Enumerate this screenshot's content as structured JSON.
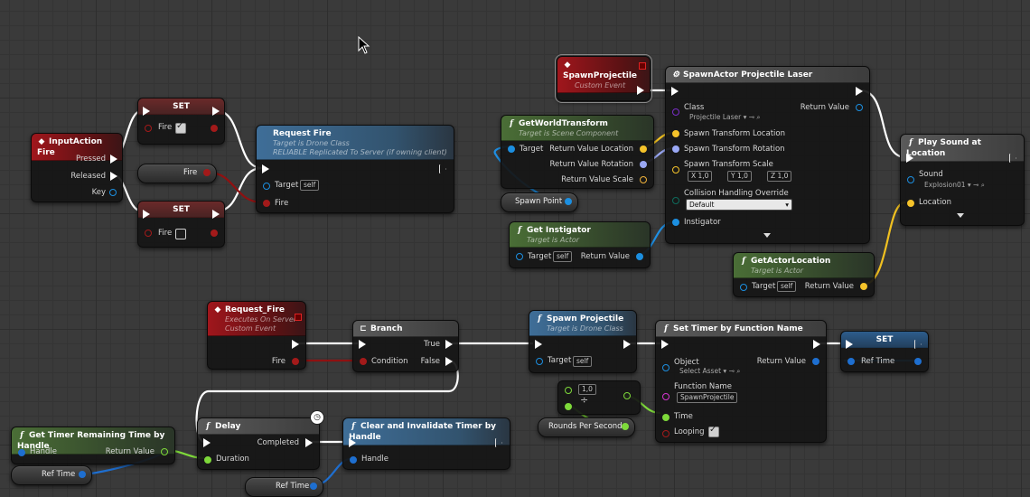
{
  "colors": {
    "exec": "#ffffff",
    "object": "#1c8fe0",
    "vector": "#f5c32a",
    "rotator": "#9aa8f5",
    "transform": "#f0b23a",
    "bool": "#a31a1a",
    "float": "#7ed93a",
    "struct": "#1e6fd0",
    "name": "#d535d0",
    "class": "#7a2dc7",
    "enum": "#0e6b5c"
  },
  "nodes": {
    "input_fire": {
      "title": "InputAction Fire",
      "pressed": "Pressed",
      "released": "Released",
      "key": "Key"
    },
    "set_true": {
      "title": "SET",
      "fire": "Fire"
    },
    "set_false": {
      "title": "SET",
      "fire": "Fire"
    },
    "fire_var": {
      "label": "Fire"
    },
    "request_fire": {
      "title": "Request Fire",
      "sub1": "Target is Drone Class",
      "sub2": "RELIABLE Replicated To Server (if owning client)",
      "target": "Target",
      "target_val": "self",
      "fire": "Fire"
    },
    "spawn_event": {
      "title": "SpawnProjectile",
      "sub": "Custom Event"
    },
    "get_world_transform": {
      "title": "GetWorldTransform",
      "sub": "Target is Scene Component",
      "target": "Target",
      "ret_loc": "Return Value Location",
      "ret_rot": "Return Value Rotation",
      "ret_scale": "Return Value Scale"
    },
    "spawn_point": {
      "label": "Spawn Point"
    },
    "spawn_actor": {
      "title": "SpawnActor Projectile Laser",
      "class": "Class",
      "class_val": "Projectile Laser",
      "ret": "Return Value",
      "loc": "Spawn Transform Location",
      "rot": "Spawn Transform Rotation",
      "scale": "Spawn Transform Scale",
      "sx": "1,0",
      "sy": "1,0",
      "sz": "1,0",
      "ax": "X",
      "ay": "Y",
      "az": "Z",
      "collision": "Collision Handling Override",
      "collision_val": "Default",
      "instigator": "Instigator"
    },
    "get_instigator": {
      "title": "Get Instigator",
      "sub": "Target is Actor",
      "target": "Target",
      "target_val": "self",
      "ret": "Return Value"
    },
    "play_sound": {
      "title": "Play Sound at Location",
      "sound": "Sound",
      "sound_val": "Explosion01",
      "location": "Location"
    },
    "get_actor_location": {
      "title": "GetActorLocation",
      "sub": "Target is Actor",
      "target": "Target",
      "target_val": "self",
      "ret": "Return Value"
    },
    "request_fire_event": {
      "title": "Request_Fire",
      "sub1": "Executes On Server",
      "sub2": "Custom Event",
      "fire": "Fire"
    },
    "branch": {
      "title": "Branch",
      "condition": "Condition",
      "true": "True",
      "false": "False"
    },
    "spawn_projectile_call": {
      "title": "Spawn Projectile",
      "sub": "Target is Drone Class",
      "target": "Target",
      "target_val": "self"
    },
    "set_timer": {
      "title": "Set Timer by Function Name",
      "object": "Object",
      "object_val": "Select Asset",
      "ret": "Return Value",
      "function": "Function Name",
      "function_val": "SpawnProjectile",
      "time": "Time",
      "looping": "Looping"
    },
    "set_ref": {
      "title": "SET",
      "ref": "Ref Time"
    },
    "divide": {
      "val": "1,0"
    },
    "rounds": {
      "label": "Rounds Per Second"
    },
    "get_timer_remaining": {
      "title": "Get Timer Remaining Time by Handle",
      "handle": "Handle",
      "ret": "Return Value"
    },
    "ref_time_a": {
      "label": "Ref Time"
    },
    "delay": {
      "title": "Delay",
      "completed": "Completed",
      "duration": "Duration"
    },
    "clear_timer": {
      "title": "Clear and Invalidate Timer by Handle",
      "handle": "Handle"
    },
    "ref_time_b": {
      "label": "Ref Time"
    }
  }
}
